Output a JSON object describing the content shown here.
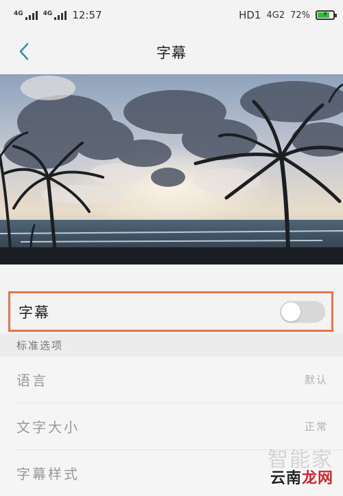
{
  "status_bar": {
    "signal1_label": "4G",
    "signal2_label": "4G",
    "time": "12:57",
    "hd_label": "HD1",
    "network_label": "4G2",
    "battery_percent": "72%",
    "battery_level": 0.72,
    "battery_color": "#2fc03a"
  },
  "header": {
    "back_icon": "chevron-left-icon",
    "title": "字幕",
    "accent_color": "#2a8fb5"
  },
  "hero": {
    "image": "beach-palm-trees-cloudy-sky"
  },
  "caption_toggle": {
    "label": "字幕",
    "enabled": false,
    "highlight_color": "#e8744a"
  },
  "section": {
    "title": "标准选项"
  },
  "options": [
    {
      "label": "语言",
      "value": "默认"
    },
    {
      "label": "文字大小",
      "value": "正常"
    },
    {
      "label": "字幕样式",
      "value": ""
    }
  ],
  "watermark": {
    "line1": "智能家",
    "line2_part1": "云南",
    "line2_part2": "龙网"
  }
}
